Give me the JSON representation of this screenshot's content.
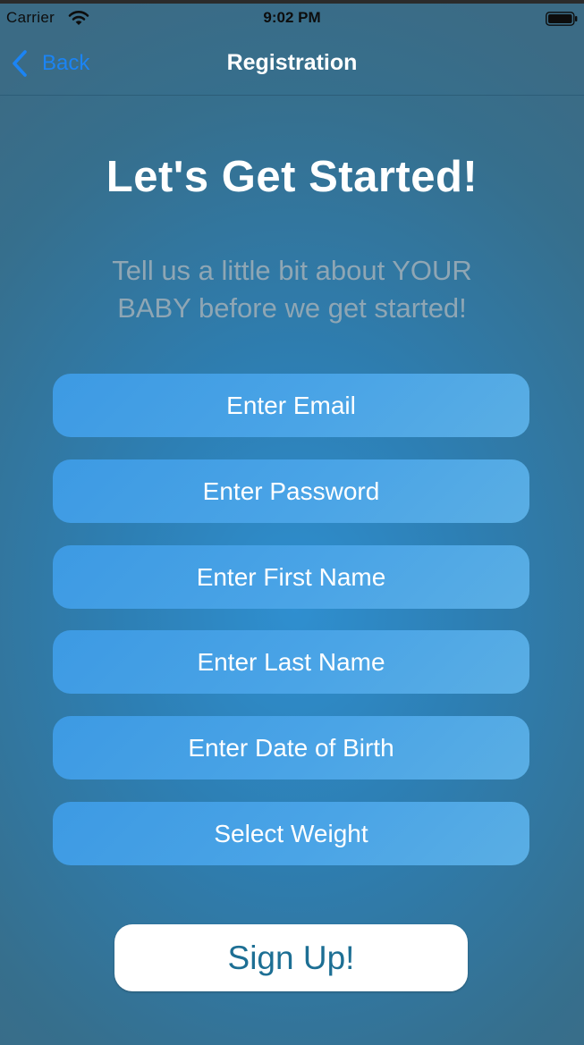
{
  "status_bar": {
    "carrier": "Carrier",
    "time": "9:02 PM",
    "icons": [
      "wifi-icon",
      "battery-icon"
    ]
  },
  "nav": {
    "back_label": "Back",
    "title": "Registration",
    "back_icon": "chevron-left-icon",
    "accent_color": "#1b84f5"
  },
  "main": {
    "headline": "Let's Get Started!",
    "subtitle": "Tell us a little bit about YOUR BABY before we get started!",
    "fields": [
      {
        "placeholder": "Enter Email"
      },
      {
        "placeholder": "Enter Password"
      },
      {
        "placeholder": "Enter First Name"
      },
      {
        "placeholder": "Enter Last Name"
      },
      {
        "placeholder": "Enter Date of Birth"
      },
      {
        "placeholder": "Select Weight"
      }
    ],
    "submit_label": "Sign Up!"
  },
  "colors": {
    "background": "#2d7fb4",
    "field": "#4aa4e6",
    "button_text": "#1d6f94",
    "subtitle_text": "#8fa6b4"
  }
}
